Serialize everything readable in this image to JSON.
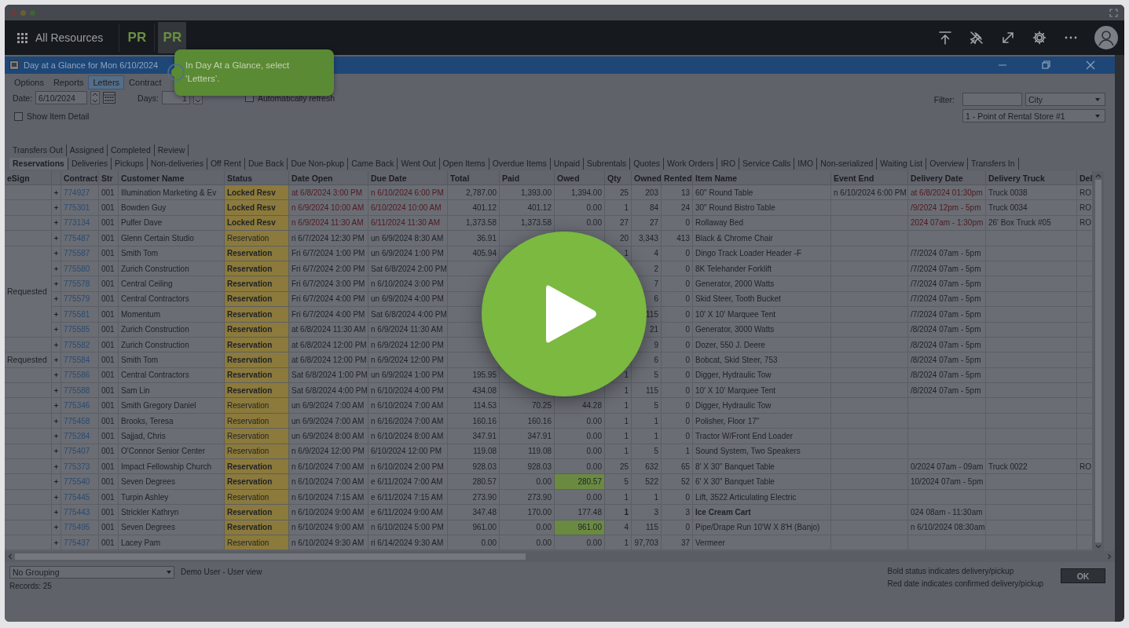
{
  "top_bar": {
    "title": "All Resources",
    "apps": [
      {
        "label": "PR",
        "selected": false
      },
      {
        "label": "PR",
        "selected": true
      }
    ]
  },
  "window": {
    "title": "Day at a Glance for Mon 6/10/2024"
  },
  "menu": [
    {
      "label": "Options",
      "selected": false
    },
    {
      "label": "Reports",
      "selected": false
    },
    {
      "label": "Letters",
      "selected": true
    },
    {
      "label": "Contract",
      "selected": false
    }
  ],
  "date": {
    "label": "Date:",
    "value": "6/10/2024"
  },
  "days": {
    "label": "Days:",
    "value": "1"
  },
  "auto_refresh": {
    "label": "Automatically refresh",
    "checked": false
  },
  "show_item_detail": {
    "label": "Show Item Detail",
    "checked": false
  },
  "filter": {
    "label": "Filter:",
    "field": "City",
    "store": "1 - Point of Rental Store #1"
  },
  "tab_rows": [
    [
      {
        "label": "Transfers Out",
        "selected": false
      },
      {
        "label": "Assigned",
        "selected": false
      },
      {
        "label": "Completed",
        "selected": false
      },
      {
        "label": "Review",
        "selected": false
      }
    ],
    [
      {
        "label": "Reservations",
        "selected": true
      },
      {
        "label": "Deliveries",
        "selected": false
      },
      {
        "label": "Pickups",
        "selected": false
      },
      {
        "label": "Non-deliveries",
        "selected": false
      },
      {
        "label": "Off Rent",
        "selected": false
      },
      {
        "label": "Due Back",
        "selected": false
      },
      {
        "label": "Due Non-pkup",
        "selected": false
      },
      {
        "label": "Came Back",
        "selected": false
      },
      {
        "label": "Went Out",
        "selected": false
      },
      {
        "label": "Open Items",
        "selected": false
      },
      {
        "label": "Overdue Items",
        "selected": false
      },
      {
        "label": "Unpaid",
        "selected": false
      },
      {
        "label": "Subrentals",
        "selected": false
      },
      {
        "label": "Quotes",
        "selected": false
      },
      {
        "label": "Work Orders",
        "selected": false
      },
      {
        "label": "IRO",
        "selected": false
      },
      {
        "label": "Service Calls",
        "selected": false
      },
      {
        "label": "IMO",
        "selected": false
      },
      {
        "label": "Non-serialized",
        "selected": false
      },
      {
        "label": "Waiting List",
        "selected": false
      },
      {
        "label": "Overview",
        "selected": false
      },
      {
        "label": "Transfers In",
        "selected": false
      }
    ]
  ],
  "table": {
    "columns": [
      "eSign",
      "Contract",
      "Str",
      "Customer Name",
      "Status",
      "Date Open",
      "Due Date",
      "Total",
      "Paid",
      "Owed",
      "Qty",
      "Owned",
      "Rented",
      "Item Name",
      "Event End",
      "Delivery Date",
      "Delivery Truck",
      "Del"
    ],
    "groups": [
      {
        "rows": [
          {
            "contract": "774927",
            "store": "001",
            "customer": "Illumination Marketing & Ev",
            "status": "Locked Resv",
            "status_bold": true,
            "date_open": "at 6/8/2024 3:00 PM",
            "due_date": "n 6/10/2024 6:00 PM",
            "dates_confirmed": true,
            "total": "2,787.00",
            "paid": "1,393.00",
            "owed": "1,394.00",
            "owed_flag": false,
            "qty": "25",
            "owned": "203",
            "rented": "13",
            "item": "60\" Round Table",
            "item_bold": false,
            "event_end": "n 6/10/2024 6:00 PM",
            "delivery_date": "at 6/8/2024 01:30pm",
            "truck": "Truck 0038",
            "del": "RO"
          }
        ]
      },
      {
        "rows": [
          {
            "contract": "775301",
            "store": "001",
            "customer": "Bowden Guy",
            "status": "Locked Resv",
            "status_bold": true,
            "date_open": "n 6/9/2024 10:00 AM",
            "due_date": "6/10/2024 10:00 AM",
            "dates_confirmed": true,
            "total": "401.12",
            "paid": "401.12",
            "owed": "0.00",
            "owed_flag": false,
            "qty": "1",
            "owned": "84",
            "rented": "24",
            "item": "30\" Round Bistro Table",
            "item_bold": false,
            "delivery_date": "/9/2024 12pm - 5pm",
            "truck": "Truck 0034",
            "del": "RO"
          }
        ]
      },
      {
        "rows": [
          {
            "contract": "773134",
            "store": "001",
            "customer": "Pulfer Dave",
            "status": "Locked Resv",
            "status_bold": true,
            "date_open": "n 6/9/2024 11:30 AM",
            "due_date": "6/11/2024 11:30 AM",
            "dates_confirmed": true,
            "total": "1,373.58",
            "paid": "1,373.58",
            "owed": "0.00",
            "owed_flag": false,
            "qty": "27",
            "owned": "27",
            "rented": "0",
            "item": "Rollaway Bed",
            "item_bold": false,
            "delivery_date": "2024 07am - 1:30pm",
            "truck": "26' Box Truck #05",
            "del": "RO"
          }
        ]
      },
      {
        "rows": [
          {
            "contract": "775487",
            "store": "001",
            "customer": "Glenn Certain Studio",
            "status": "Reservation",
            "status_bold": false,
            "date_open": "ri 6/7/2024 12:30 PM",
            "due_date": "un 6/9/2024 8:30 AM",
            "dates_confirmed": false,
            "total": "36.91",
            "qty": "20",
            "owned": "3,343",
            "rented": "413",
            "item": "Black & Chrome Chair",
            "item_bold": false
          }
        ]
      },
      {
        "esign": "Requested",
        "rows": [
          {
            "contract": "775587",
            "store": "001",
            "customer": "Smith Tom",
            "status": "Reservation",
            "status_bold": true,
            "date_open": "Fri 6/7/2024 1:00 PM",
            "due_date": "un 6/9/2024 1:00 PM",
            "dates_confirmed": false,
            "total": "405.94",
            "qty": "1",
            "owned": "4",
            "rented": "0",
            "item": "Dingo Track Loader  Header -F",
            "item_bold": false,
            "delivery_date": "/7/2024 07am - 5pm"
          },
          {
            "contract": "775580",
            "store": "001",
            "customer": "Zurich Construction",
            "status": "Reservation",
            "status_bold": true,
            "date_open": "Fri 6/7/2024 2:00 PM",
            "due_date": "Sat 6/8/2024 2:00 PM",
            "dates_confirmed": false,
            "owned": "2",
            "rented": "0",
            "item": "8K Telehander Forklift",
            "item_bold": false,
            "delivery_date": "/7/2024 07am - 5pm"
          },
          {
            "contract": "775578",
            "store": "001",
            "customer": "Central Ceiling",
            "status": "Reservation",
            "status_bold": true,
            "date_open": "Fri 6/7/2024 3:00 PM",
            "due_date": "n 6/10/2024 3:00 PM",
            "dates_confirmed": false,
            "owned": "7",
            "rented": "0",
            "item": "Generator, 2000 Watts",
            "item_bold": false,
            "delivery_date": "/7/2024 07am - 5pm"
          },
          {
            "contract": "775579",
            "store": "001",
            "customer": "Central Contractors",
            "status": "Reservation",
            "status_bold": true,
            "date_open": "Fri 6/7/2024 4:00 PM",
            "due_date": "un 6/9/2024 4:00 PM",
            "dates_confirmed": false,
            "owned": "6",
            "rented": "0",
            "item": "Skid Steer, Tooth Bucket",
            "item_bold": false,
            "delivery_date": "/7/2024 07am - 5pm"
          },
          {
            "contract": "775581",
            "store": "001",
            "customer": "Momentum",
            "status": "Reservation",
            "status_bold": true,
            "date_open": "Fri 6/7/2024 4:00 PM",
            "due_date": "Sat 6/8/2024 4:00 PM",
            "dates_confirmed": false,
            "owned": "115",
            "rented": "0",
            "item": "10' X 10' Marquee Tent",
            "item_bold": false,
            "delivery_date": "/7/2024 07am - 5pm"
          },
          {
            "contract": "775585",
            "store": "001",
            "customer": "Zurich Construction",
            "status": "Reservation",
            "status_bold": true,
            "date_open": "at 6/8/2024 11:30 AM",
            "due_date": "n 6/9/2024 11:30 AM",
            "dates_confirmed": false,
            "owned": "21",
            "rented": "0",
            "item": "Generator, 3000 Watts",
            "item_bold": false,
            "delivery_date": "/8/2024 07am - 5pm"
          }
        ]
      },
      {
        "rows": [
          {
            "contract": "775582",
            "store": "001",
            "customer": "Zurich Construction",
            "status": "Reservation",
            "status_bold": true,
            "date_open": "at 6/8/2024 12:00 PM",
            "due_date": "n 6/9/2024 12:00 PM",
            "dates_confirmed": false,
            "owned": "9",
            "rented": "0",
            "item": "Dozer, 550 J. Deere",
            "item_bold": false,
            "delivery_date": "/8/2024 07am - 5pm"
          }
        ]
      },
      {
        "esign": "Requested",
        "rows": [
          {
            "contract": "775584",
            "store": "001",
            "customer": "Smith Tom",
            "status": "Reservation",
            "status_bold": true,
            "date_open": "at 6/8/2024 12:00 PM",
            "due_date": "n 6/9/2024 12:00 PM",
            "dates_confirmed": false,
            "owned": "6",
            "rented": "0",
            "item": "Bobcat, Skid Steer, 753",
            "item_bold": false,
            "delivery_date": "/8/2024 07am - 5pm"
          }
        ]
      },
      {
        "rows": [
          {
            "contract": "775586",
            "store": "001",
            "customer": "Central Contractors",
            "status": "Reservation",
            "status_bold": true,
            "date_open": "Sat 6/8/2024 1:00 PM",
            "due_date": "un 6/9/2024 1:00 PM",
            "dates_confirmed": false,
            "total": "195.95",
            "qty": "1",
            "owned": "5",
            "rented": "0",
            "item": "Digger,  Hydraulic Tow",
            "item_bold": false,
            "delivery_date": "/8/2024 07am - 5pm"
          }
        ]
      },
      {
        "rows": [
          {
            "contract": "775588",
            "store": "001",
            "customer": "Sam Lin",
            "status": "Reservation",
            "status_bold": true,
            "date_open": "Sat 6/8/2024 4:00 PM",
            "due_date": "n 6/10/2024 4:00 PM",
            "dates_confirmed": false,
            "total": "434.08",
            "qty": "1",
            "owned": "115",
            "rented": "0",
            "item": "10' X 10' Marquee Tent",
            "item_bold": false,
            "delivery_date": "/8/2024 07am - 5pm"
          }
        ]
      },
      {
        "rows": [
          {
            "contract": "775346",
            "store": "001",
            "customer": "Smith Gregory Daniel",
            "status": "Reservation",
            "status_bold": false,
            "date_open": "un 6/9/2024 7:00 AM",
            "due_date": "n 6/10/2024 7:00 AM",
            "dates_confirmed": false,
            "total": "114.53",
            "paid": "70.25",
            "owed": "44.28",
            "owed_flag": false,
            "qty": "1",
            "owned": "5",
            "rented": "0",
            "item": "Digger,  Hydraulic Tow",
            "item_bold": false
          }
        ]
      },
      {
        "rows": [
          {
            "contract": "775458",
            "store": "001",
            "customer": "Brooks, Teresa",
            "status": "Reservation",
            "status_bold": false,
            "date_open": "un 6/9/2024 7:00 AM",
            "due_date": "n 6/16/2024 7:00 AM",
            "dates_confirmed": false,
            "total": "160.16",
            "paid": "160.16",
            "owed": "0.00",
            "owed_flag": false,
            "qty": "1",
            "owned": "1",
            "rented": "0",
            "item": "Polisher, Floor 17\"",
            "item_bold": false
          }
        ]
      },
      {
        "rows": [
          {
            "contract": "775284",
            "store": "001",
            "customer": "Sajjad, Chris",
            "status": "Reservation",
            "status_bold": false,
            "date_open": "un 6/9/2024 8:00 AM",
            "due_date": "n 6/10/2024 8:00 AM",
            "dates_confirmed": false,
            "total": "347.91",
            "paid": "347.91",
            "owed": "0.00",
            "owed_flag": false,
            "qty": "1",
            "owned": "1",
            "rented": "0",
            "item": "Tractor W/Front End Loader",
            "item_bold": false
          }
        ]
      },
      {
        "rows": [
          {
            "contract": "775407",
            "store": "001",
            "customer": "O'Connor Senior Center",
            "status": "Reservation",
            "status_bold": false,
            "date_open": "n 6/9/2024 12:00 PM",
            "due_date": "6/10/2024 12:00 PM",
            "dates_confirmed": false,
            "total": "119.08",
            "paid": "119.08",
            "owed": "0.00",
            "owed_flag": false,
            "qty": "1",
            "owned": "5",
            "rented": "1",
            "item": "Sound System, Two Speakers",
            "item_bold": false
          }
        ]
      },
      {
        "rows": [
          {
            "contract": "775373",
            "store": "001",
            "customer": "Impact Fellowship Church",
            "status": "Reservation",
            "status_bold": true,
            "date_open": "n 6/10/2024 7:00 AM",
            "due_date": "n 6/10/2024 2:00 PM",
            "dates_confirmed": false,
            "total": "928.03",
            "paid": "928.03",
            "owed": "0.00",
            "owed_flag": false,
            "qty": "25",
            "owned": "632",
            "rented": "65",
            "item": "8' X 30\" Banquet Table",
            "item_bold": false,
            "delivery_date": "0/2024 07am - 09am",
            "truck": "Truck 0022",
            "del": "RO"
          }
        ]
      },
      {
        "rows": [
          {
            "contract": "775540",
            "store": "001",
            "customer": "Seven Degrees",
            "status": "Reservation",
            "status_bold": true,
            "date_open": "n 6/10/2024 7:00 AM",
            "due_date": "e 6/11/2024 7:00 AM",
            "dates_confirmed": false,
            "total": "280.57",
            "paid": "0.00",
            "owed": "280.57",
            "owed_flag": true,
            "qty": "5",
            "owned": "522",
            "rented": "52",
            "item": "6' X 30\" Banquet Table",
            "item_bold": false,
            "delivery_date": "10/2024 07am - 5pm"
          }
        ]
      },
      {
        "rows": [
          {
            "contract": "775445",
            "store": "001",
            "customer": "Turpin Ashley",
            "status": "Reservation",
            "status_bold": false,
            "date_open": "n 6/10/2024 7:15 AM",
            "due_date": "e 6/11/2024 7:15 AM",
            "dates_confirmed": false,
            "total": "273.90",
            "paid": "273.90",
            "owed": "0.00",
            "owed_flag": false,
            "qty": "1",
            "owned": "1",
            "rented": "0",
            "item": "Lift, 3522 Articulating Electric",
            "item_bold": false
          }
        ]
      },
      {
        "rows": [
          {
            "contract": "775443",
            "store": "001",
            "customer": "Strickler Kathryn",
            "status": "Reservation",
            "status_bold": true,
            "date_open": "n 6/10/2024 9:00 AM",
            "due_date": "e 6/11/2024 9:00 AM",
            "dates_confirmed": false,
            "total": "347.48",
            "paid": "170.00",
            "owed": "177.48",
            "owed_flag": false,
            "qty": "1",
            "owned": "3",
            "rented": "3",
            "item": "Ice Cream Cart",
            "item_bold": true,
            "delivery_date": "024 08am - 11:30am"
          }
        ]
      },
      {
        "rows": [
          {
            "contract": "775495",
            "store": "001",
            "customer": "Seven Degrees",
            "status": "Reservation",
            "status_bold": true,
            "date_open": "n 6/10/2024 9:00 AM",
            "due_date": "n 6/10/2024 5:00 PM",
            "dates_confirmed": false,
            "total": "961.00",
            "paid": "0.00",
            "owed": "961.00",
            "owed_flag": true,
            "qty": "4",
            "owned": "115",
            "rented": "0",
            "item": "Pipe/Drape Run 10'W X 8'H (Banjo)",
            "item_bold": false,
            "delivery_date": "n 6/10/2024 08:30am"
          }
        ]
      },
      {
        "rows": [
          {
            "contract": "775437",
            "store": "001",
            "customer": "Lacey Pam",
            "status": "Reservation",
            "status_bold": false,
            "date_open": "n 6/10/2024 9:30 AM",
            "due_date": "ri 6/14/2024 9:30 AM",
            "dates_confirmed": false,
            "total": "0.00",
            "paid": "0.00",
            "owed": "0.00",
            "owed_flag": false,
            "qty": "1",
            "owned": "97,703",
            "rented": "37",
            "item": "Vermeer",
            "item_bold": false
          }
        ]
      }
    ]
  },
  "footer": {
    "grouping": "No Grouping",
    "user": "Demo User - User view",
    "records": "Records: 25",
    "legend": [
      "Bold status indicates delivery/pickup",
      "Red date indicates confirmed delivery/pickup"
    ],
    "ok": "OK"
  },
  "tooltip": {
    "text": "In Day At a Glance, select ‘Letters’."
  }
}
